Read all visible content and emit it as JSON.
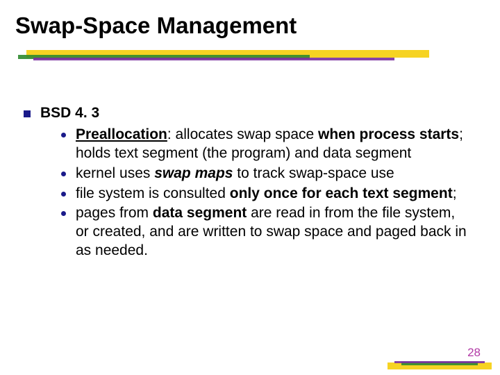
{
  "title": "Swap-Space Management",
  "top": {
    "label": "BSD 4. 3"
  },
  "bullets": {
    "b1": {
      "s1": "Preallocation",
      "s2": ": allocates swap space ",
      "s3": "when process starts",
      "s4": "; holds text segment (the program) and data segment"
    },
    "b2": {
      "s1": "kernel uses ",
      "s2": "swap maps",
      "s3": " to track swap-space use"
    },
    "b3": {
      "s1": "file system is consulted ",
      "s2": "only once for each text segment",
      "s3": ";"
    },
    "b4": {
      "s1": "pages from ",
      "s2": "data segment",
      "s3": " are read in from the file system, or created, and are written to swap space and paged back in as needed."
    }
  },
  "page_number": "28"
}
